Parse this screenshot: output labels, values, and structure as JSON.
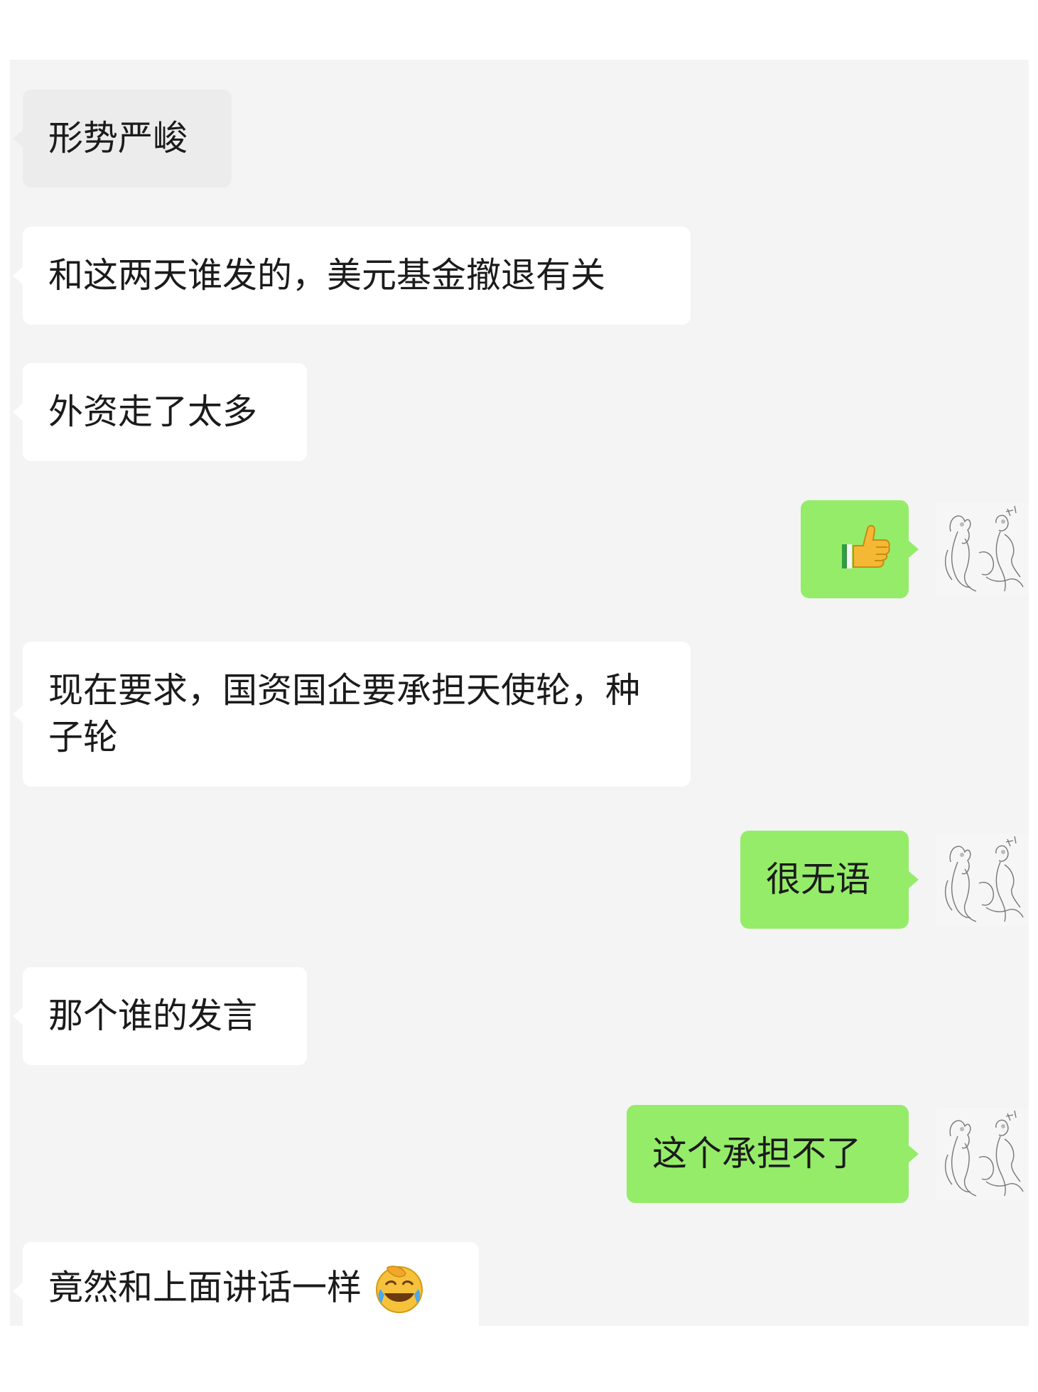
{
  "messages": [
    {
      "side": "left",
      "text": "形势严峻"
    },
    {
      "side": "left",
      "text": "和这两天谁发的，美元基金撤退有关"
    },
    {
      "side": "left",
      "text": "外资走了太多"
    },
    {
      "side": "right",
      "text": "",
      "emoji": "thumbs-up"
    },
    {
      "side": "left",
      "text": "现在要求，国资国企要承担天使轮，种子轮"
    },
    {
      "side": "right",
      "text": "很无语"
    },
    {
      "side": "left",
      "text": "那个谁的发言"
    },
    {
      "side": "right",
      "text": "这个承担不了"
    },
    {
      "side": "left",
      "text": "竟然和上面讲话一样",
      "emoji": "face-with-tears-of-joy-in-hand"
    }
  ],
  "colors": {
    "chat_background": "#f4f4f4",
    "left_bubble": "#ffffff",
    "right_bubble": "#95ec69",
    "text": "#1b1b1b"
  },
  "icons": [
    "thumbs-up-emoji",
    "facepalm-laugh-emoji",
    "sketch-avatar"
  ]
}
